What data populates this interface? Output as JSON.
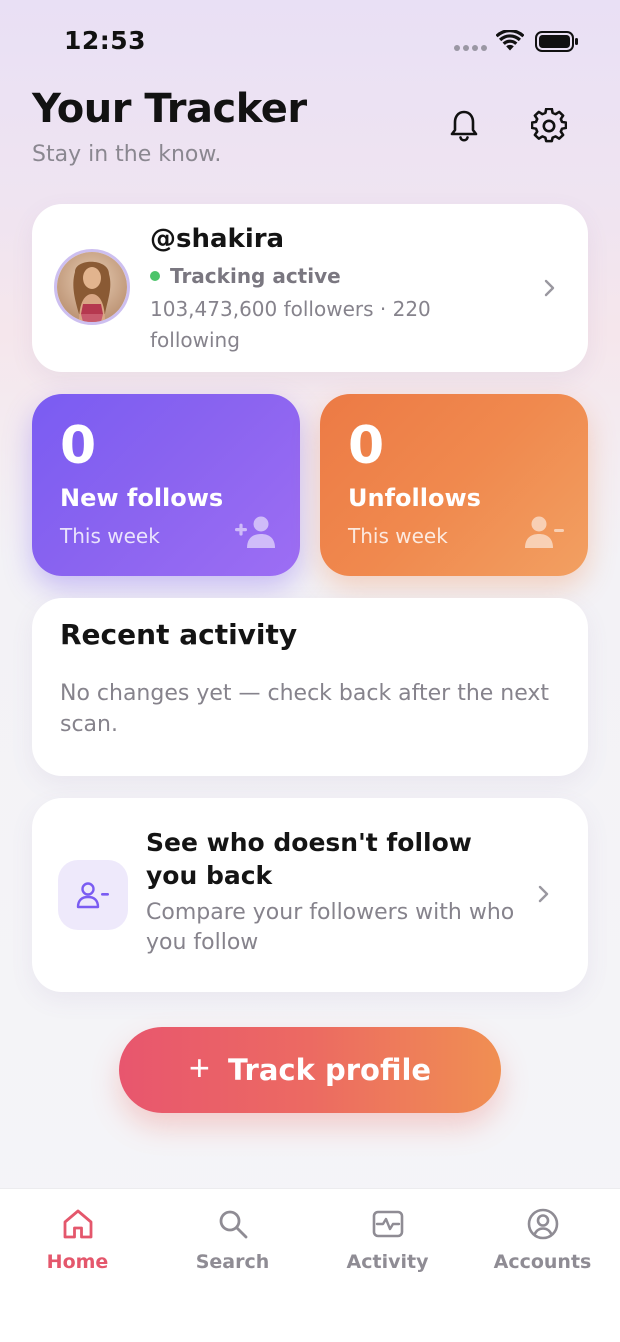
{
  "status_bar": {
    "time": "12:53"
  },
  "header": {
    "title": "Your Tracker",
    "subtitle": "Stay in the know."
  },
  "profile": {
    "username": "@shakira",
    "tracking_status": "Tracking active",
    "stats": "103,473,600 followers · 220 following"
  },
  "stats": {
    "new_follows": {
      "value": "0",
      "label": "New follows",
      "sub": "This week"
    },
    "unfollows": {
      "value": "0",
      "label": "Unfollows",
      "sub": "This week"
    }
  },
  "activity": {
    "title": "Recent activity",
    "empty_text": "No changes yet — check back after the next scan."
  },
  "compare": {
    "title": "See who doesn't follow you back",
    "subtitle": "Compare your followers with who you follow"
  },
  "track_button": {
    "label": "Track profile"
  },
  "tabs": [
    {
      "label": "Home",
      "icon": "home-icon",
      "active": true
    },
    {
      "label": "Search",
      "icon": "search-icon",
      "active": false
    },
    {
      "label": "Activity",
      "icon": "activity-icon",
      "active": false
    },
    {
      "label": "Accounts",
      "icon": "account-icon",
      "active": false
    }
  ],
  "colors": {
    "accent": "#e4576c",
    "new_follows_card": "#8b64f0",
    "unfollows_card": "#f0894e",
    "tracking_dot": "#4cc46a"
  }
}
